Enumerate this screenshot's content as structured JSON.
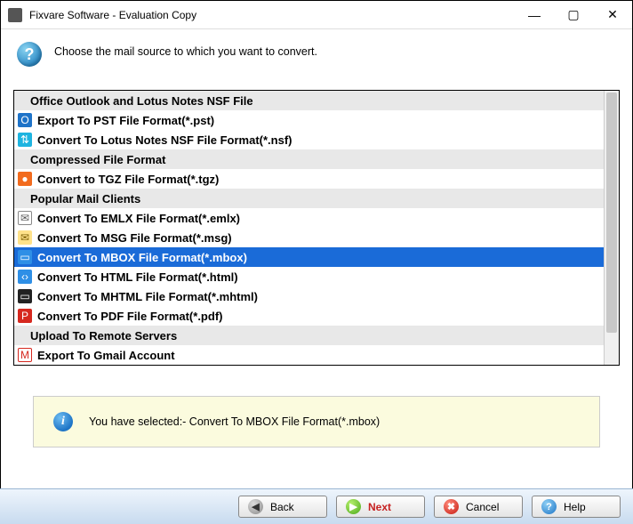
{
  "window": {
    "title": "Fixvare Software - Evaluation Copy"
  },
  "instruction": "Choose the mail source to which you want to convert.",
  "list": [
    {
      "type": "header",
      "label": "Office Outlook and Lotus Notes NSF File"
    },
    {
      "type": "item",
      "icon": "outlook",
      "label": "Export To PST File Format(*.pst)"
    },
    {
      "type": "item",
      "icon": "nsf",
      "label": "Convert To Lotus Notes NSF File Format(*.nsf)"
    },
    {
      "type": "header",
      "label": "Compressed File Format"
    },
    {
      "type": "item",
      "icon": "tgz",
      "label": "Convert to TGZ File Format(*.tgz)"
    },
    {
      "type": "header",
      "label": "Popular Mail Clients"
    },
    {
      "type": "item",
      "icon": "emlx",
      "label": "Convert To EMLX File Format(*.emlx)"
    },
    {
      "type": "item",
      "icon": "msg",
      "label": "Convert To MSG File Format(*.msg)"
    },
    {
      "type": "item",
      "icon": "mbox",
      "label": "Convert To MBOX File Format(*.mbox)",
      "selected": true
    },
    {
      "type": "item",
      "icon": "html",
      "label": "Convert To HTML File Format(*.html)"
    },
    {
      "type": "item",
      "icon": "mhtml",
      "label": "Convert To MHTML File Format(*.mhtml)"
    },
    {
      "type": "item",
      "icon": "pdf",
      "label": "Convert To PDF File Format(*.pdf)"
    },
    {
      "type": "header",
      "label": "Upload To Remote Servers"
    },
    {
      "type": "item",
      "icon": "gmail",
      "label": "Export To Gmail Account"
    }
  ],
  "status": "You have selected:- Convert To MBOX File Format(*.mbox)",
  "buttons": {
    "back": "Back",
    "next": "Next",
    "cancel": "Cancel",
    "help": "Help"
  },
  "icons": {
    "outlook": {
      "bg": "#1e73c8",
      "fg": "#fff",
      "glyph": "O"
    },
    "nsf": {
      "bg": "#1eb4e0",
      "fg": "#fff",
      "glyph": "⇅"
    },
    "tgz": {
      "bg": "#f26b1d",
      "fg": "#fff",
      "glyph": "●"
    },
    "emlx": {
      "bg": "#fff",
      "fg": "#555",
      "glyph": "✉",
      "border": "#888"
    },
    "msg": {
      "bg": "#ffe28a",
      "fg": "#7a5c00",
      "glyph": "✉"
    },
    "mbox": {
      "bg": "#2e8fe6",
      "fg": "#fff",
      "glyph": "▭"
    },
    "html": {
      "bg": "#2e8fe6",
      "fg": "#fff",
      "glyph": "‹›"
    },
    "mhtml": {
      "bg": "#222",
      "fg": "#fff",
      "glyph": "▭"
    },
    "pdf": {
      "bg": "#d6281f",
      "fg": "#fff",
      "glyph": "P"
    },
    "gmail": {
      "bg": "#fff",
      "fg": "#d6281f",
      "glyph": "M",
      "border": "#d6281f"
    }
  }
}
